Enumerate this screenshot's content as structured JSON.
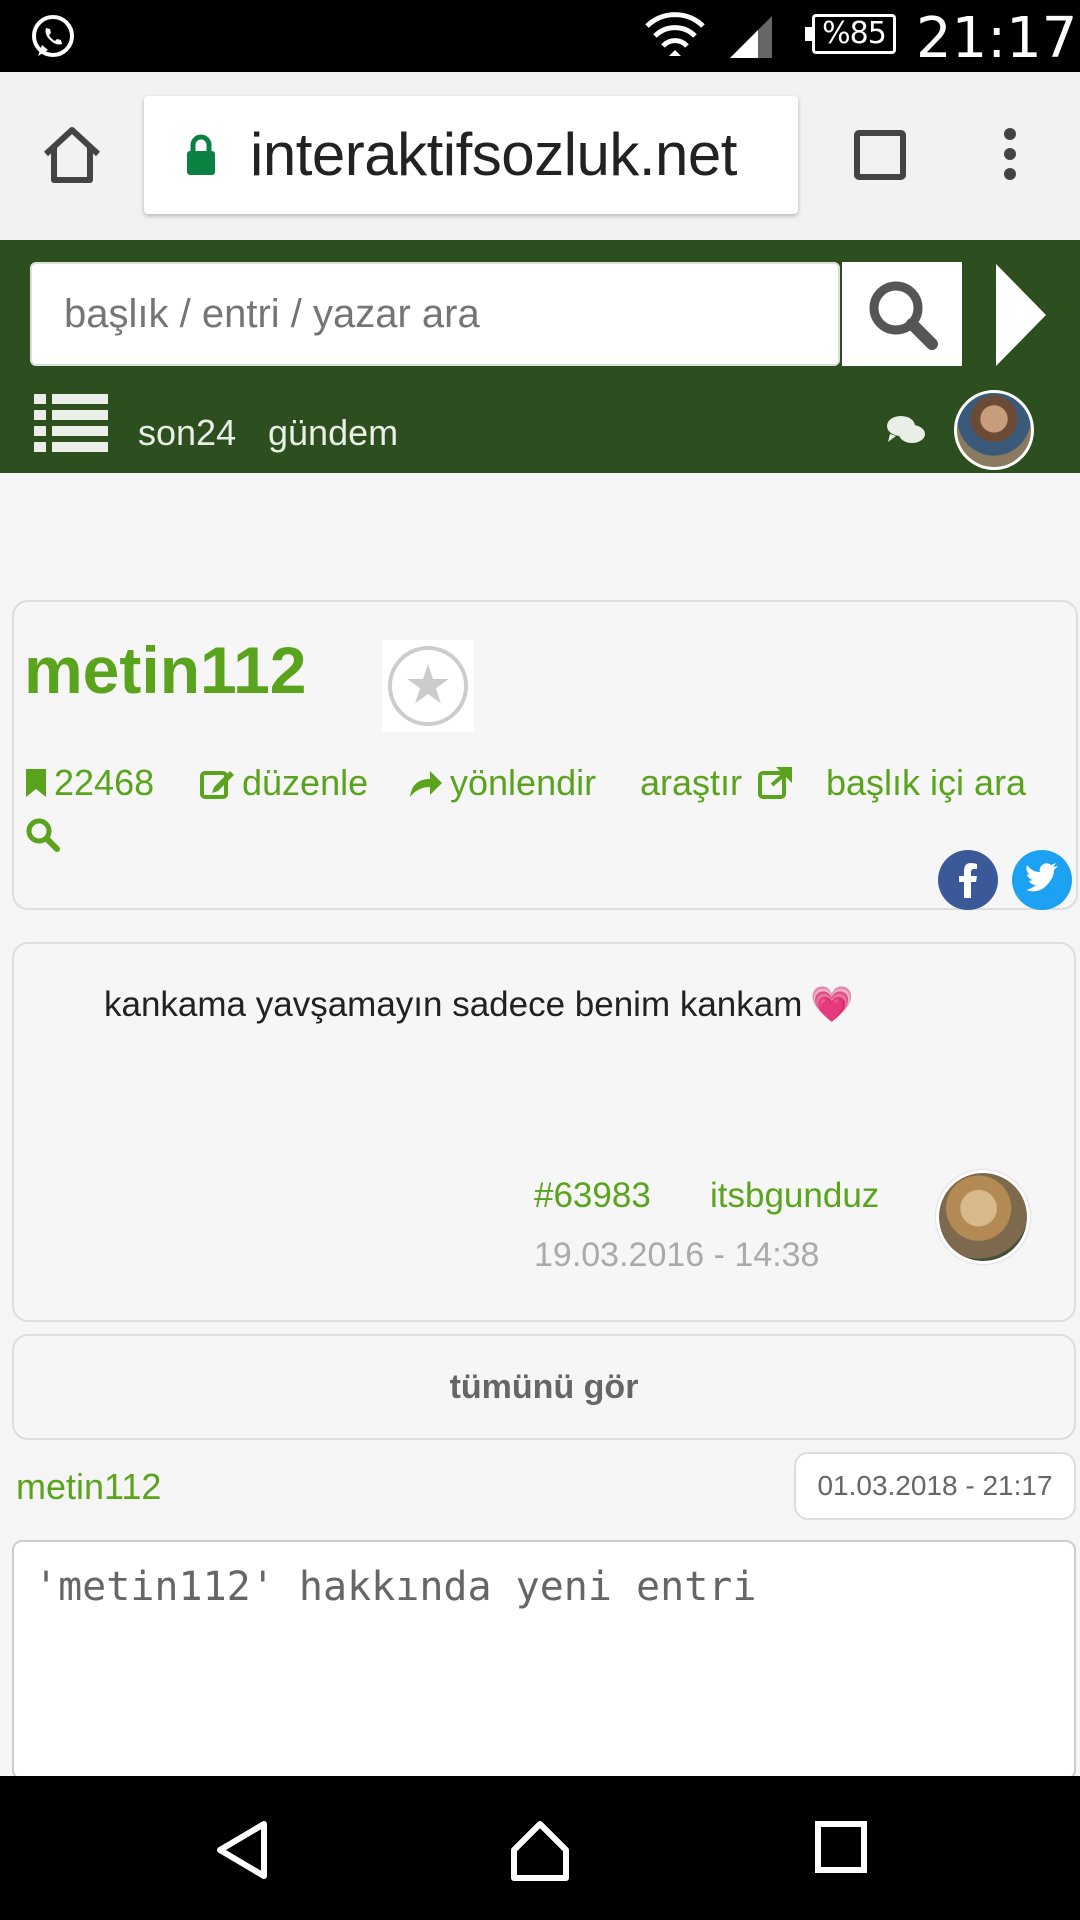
{
  "status_bar": {
    "battery": "%85",
    "time": "21:17"
  },
  "browser": {
    "url": "interaktifsozluk.net"
  },
  "header": {
    "search_placeholder": "başlık / entri / yazar ara",
    "nav": [
      "son24",
      "gündem"
    ]
  },
  "topic": {
    "title": "metin112",
    "entry_count": "22468",
    "edit_label": "düzenle",
    "redirect_label": "yönlendir",
    "research_label": "araştır",
    "search_in_topic_label": "başlık içi ara"
  },
  "entry": {
    "text": "kankama yavşamayın sadece benim kankam",
    "id": "#63983",
    "author": "itsbgunduz",
    "date": "19.03.2016 - 14:38"
  },
  "see_all_label": "tümünü gör",
  "composer": {
    "user": "metin112",
    "date": "01.03.2018 - 21:17",
    "placeholder": "'metin112' hakkında yeni entri"
  },
  "colors": {
    "brand_green": "#2d4e1e",
    "link_green": "#5aa31d"
  }
}
